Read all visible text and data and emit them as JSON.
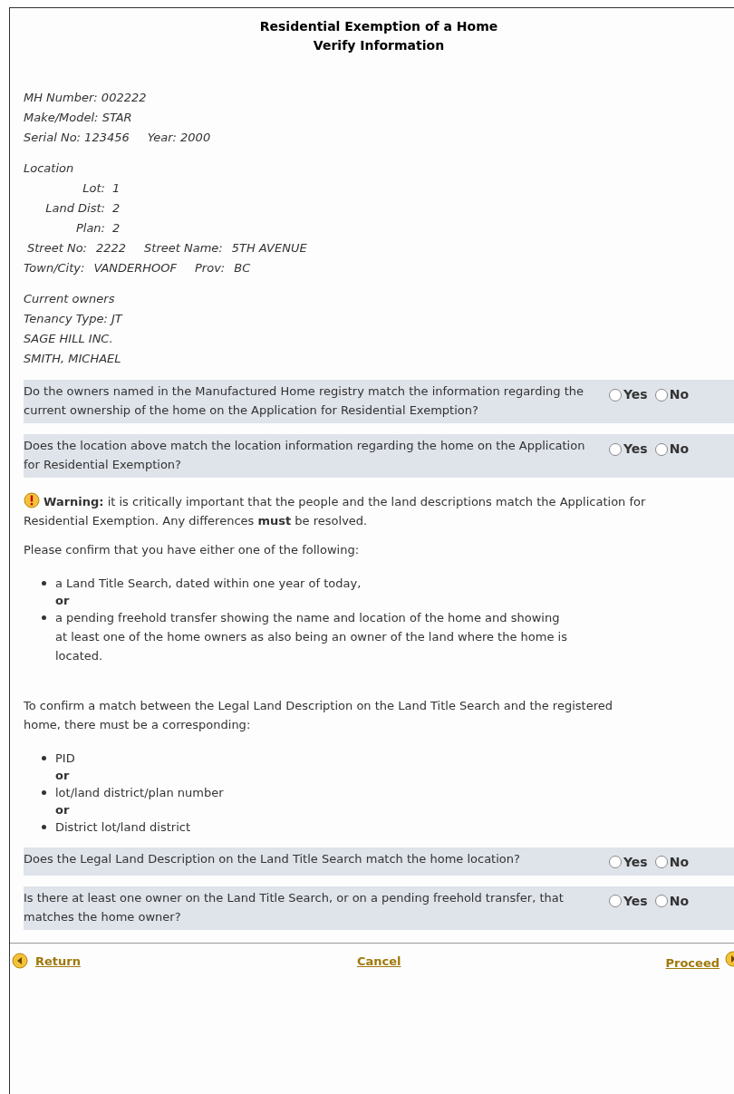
{
  "title": [
    "Residential Exemption of a Home",
    "Verify Information"
  ],
  "home": {
    "mh_number": "MH Number: 002222",
    "make_model": "Make/Model: STAR",
    "serial": "Serial No: 123456",
    "year": "Year: 2000"
  },
  "location": {
    "heading": "Location",
    "fields": [
      {
        "label": "Lot:",
        "value": "1"
      },
      {
        "label": "Land Dist:",
        "value": "2"
      },
      {
        "label": "Plan:",
        "value": "2"
      }
    ],
    "address_lines": [
      [
        {
          "label": "Street No:",
          "value": "2222"
        },
        {
          "label": "Street Name:",
          "value": "5TH AVENUE"
        }
      ],
      [
        {
          "label": "Town/City:",
          "value": "VANDERHOOF"
        },
        {
          "label": "Prov:",
          "value": "BC"
        }
      ]
    ]
  },
  "owners": {
    "heading": "Current owners",
    "tenancy": "Tenancy Type: JT",
    "names": [
      "SAGE HILL INC.",
      "SMITH, MICHAEL"
    ]
  },
  "questions_top": [
    {
      "text": "Do the owners named in the Manufactured Home registry match the information regarding the current ownership of the home on the Application for Residential Exemption?",
      "options": [
        {
          "label": "Yes",
          "selected": false
        },
        {
          "label": "No",
          "selected": false
        }
      ]
    },
    {
      "text": "Does the location above match the location information regarding the home on the Application for Residential Exemption?",
      "options": [
        {
          "label": "Yes",
          "selected": false
        },
        {
          "label": "No",
          "selected": false
        }
      ]
    }
  ],
  "warning": "**Warning:** it is critically important that the people and the land descriptions match the Application for Residential Exemption. Any differences **must** be resolved.",
  "confirm_text": "Please confirm that you have either one of the following:",
  "confirm_list": [
    {
      "kind": "item",
      "text": "a Land Title Search, dated within one year of today,"
    },
    {
      "kind": "or",
      "text": "or"
    },
    {
      "kind": "item",
      "text": "a pending freehold transfer showing the name and location of the home and showing at least one of the home owners as also being an owner of the land where the home is located."
    }
  ],
  "match_text": "To confirm a match between the Legal Land Description on the Land Title Search and the registered home, there must be a corresponding:",
  "match_list": [
    {
      "kind": "item",
      "text": "PID"
    },
    {
      "kind": "or",
      "text": "or"
    },
    {
      "kind": "item",
      "text": "lot/land district/plan number"
    },
    {
      "kind": "or",
      "text": "or"
    },
    {
      "kind": "item",
      "text": "District lot/land district"
    }
  ],
  "questions_bottom": [
    {
      "text": "Does the Legal Land Description on the Land Title Search match the home location?",
      "options": [
        {
          "label": "Yes",
          "selected": false
        },
        {
          "label": "No",
          "selected": false
        }
      ]
    },
    {
      "text": "Is there at least one owner on the Land Title Search, or on a pending freehold transfer, that matches the home owner?",
      "options": [
        {
          "label": "Yes",
          "selected": false
        },
        {
          "label": "No",
          "selected": false
        }
      ]
    }
  ],
  "footer": {
    "return": "Return",
    "cancel": "Cancel",
    "proceed": "Proceed"
  }
}
